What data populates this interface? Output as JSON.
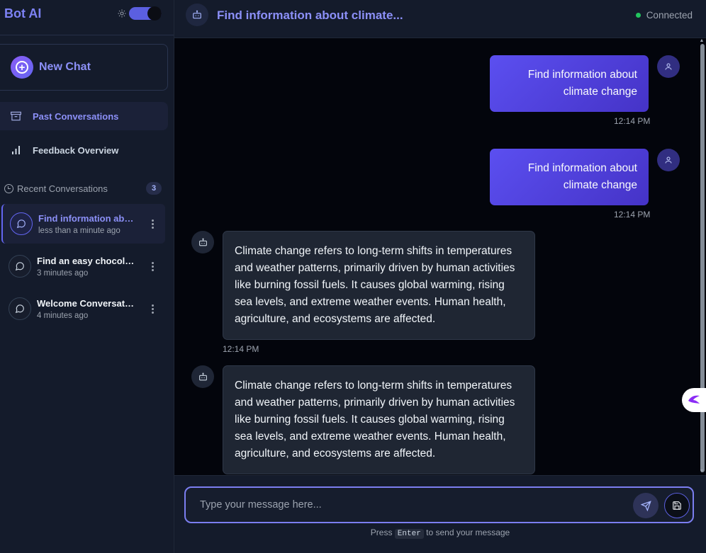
{
  "app": {
    "brand": "Bot AI"
  },
  "sidebar": {
    "new_chat_label": "New Chat",
    "nav": [
      {
        "label": "Past Conversations",
        "icon": "archive-icon",
        "active": true
      },
      {
        "label": "Feedback Overview",
        "icon": "bar-chart-icon",
        "active": false
      }
    ],
    "recent_heading": "Recent Conversations",
    "recent_count": "3",
    "conversations": [
      {
        "title": "Find information about climate change",
        "time": "less than a minute ago",
        "active": true
      },
      {
        "title": "Find an easy chocolate recipe",
        "time": "3 minutes ago",
        "active": false
      },
      {
        "title": "Welcome Conversation",
        "time": "4 minutes ago",
        "active": false
      }
    ]
  },
  "header": {
    "title": "Find information about climate...",
    "status": "Connected",
    "status_color": "#22c55e"
  },
  "messages": [
    {
      "role": "user",
      "text": "Find information about climate change",
      "time": "12:14 PM"
    },
    {
      "role": "user",
      "text": "Find information about climate change",
      "time": "12:14 PM"
    },
    {
      "role": "bot",
      "text": "Climate change refers to long-term shifts in temperatures and weather patterns, primarily driven by human activities like burning fossil fuels. It causes global warming, rising sea levels, and extreme weather events. Human health, agriculture, and ecosystems are affected.",
      "time": "12:14 PM"
    },
    {
      "role": "bot",
      "text": "Climate change refers to long-term shifts in temperatures and weather patterns, primarily driven by human activities like burning fossil fuels. It causes global warming, rising sea levels, and extreme weather events. Human health, agriculture, and ecosystems are affected.",
      "time": ""
    }
  ],
  "composer": {
    "placeholder": "Type your message here...",
    "hint_before": "Press",
    "hint_key": "Enter",
    "hint_after": "to send your message"
  },
  "colors": {
    "accent": "#6366f1",
    "user_bubble": "#5b4ff0",
    "bot_bubble": "#1f2633"
  }
}
